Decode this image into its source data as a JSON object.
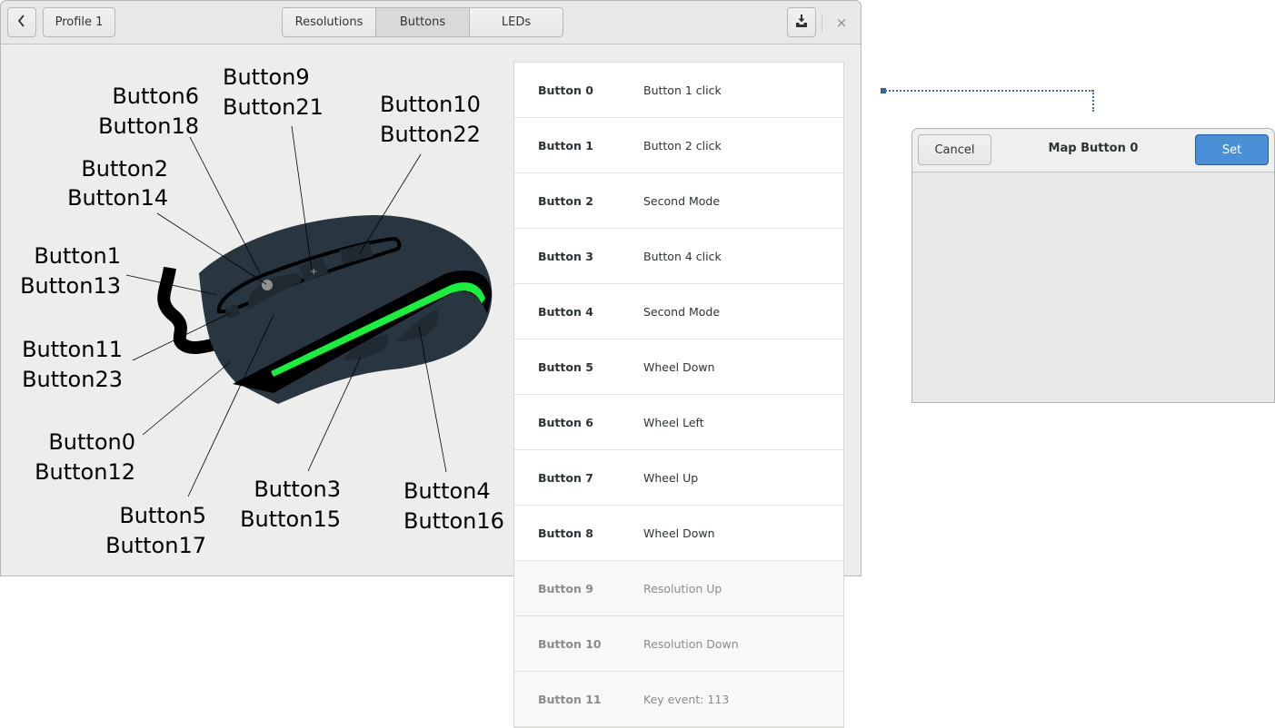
{
  "window": {
    "header": {
      "back_icon": "chevron-left-icon",
      "profile_label": "Profile 1",
      "tabs": [
        {
          "label": "Resolutions",
          "active": false
        },
        {
          "label": "Buttons",
          "active": true
        },
        {
          "label": "LEDs",
          "active": false
        }
      ],
      "save_icon": "download-save-icon",
      "close_glyph": "×"
    },
    "diagram": {
      "callouts": [
        {
          "line1": "Button6",
          "line2": "Button18"
        },
        {
          "line1": "Button9",
          "line2": "Button21"
        },
        {
          "line1": "Button10",
          "line2": "Button22"
        },
        {
          "line1": "Button2",
          "line2": "Button14"
        },
        {
          "line1": "Button1",
          "line2": "Button13"
        },
        {
          "line1": "Button11",
          "line2": "Button23"
        },
        {
          "line1": "Button0",
          "line2": "Button12"
        },
        {
          "line1": "Button5",
          "line2": "Button17"
        },
        {
          "line1": "Button3",
          "line2": "Button15"
        },
        {
          "line1": "Button4",
          "line2": "Button16"
        }
      ],
      "colors": {
        "body": "#283642",
        "led": "#19f03c"
      }
    },
    "button_list": [
      {
        "name": "Button 0",
        "action": "Button 1 click"
      },
      {
        "name": "Button 1",
        "action": "Button 2 click"
      },
      {
        "name": "Button 2",
        "action": "Second Mode"
      },
      {
        "name": "Button 3",
        "action": "Button 4 click"
      },
      {
        "name": "Button 4",
        "action": "Second Mode"
      },
      {
        "name": "Button 5",
        "action": "Wheel Down"
      },
      {
        "name": "Button 6",
        "action": "Wheel Left"
      },
      {
        "name": "Button 7",
        "action": "Wheel Up"
      },
      {
        "name": "Button 8",
        "action": "Wheel Down"
      },
      {
        "name": "Button 9",
        "action": "Resolution Up"
      },
      {
        "name": "Button 10",
        "action": "Resolution Down"
      },
      {
        "name": "Button 11",
        "action": "Key event: 113"
      }
    ]
  },
  "map_dialog": {
    "title": "Map Button 0",
    "cancel_label": "Cancel",
    "set_label": "Set",
    "accent_color": "#4a90d9"
  }
}
